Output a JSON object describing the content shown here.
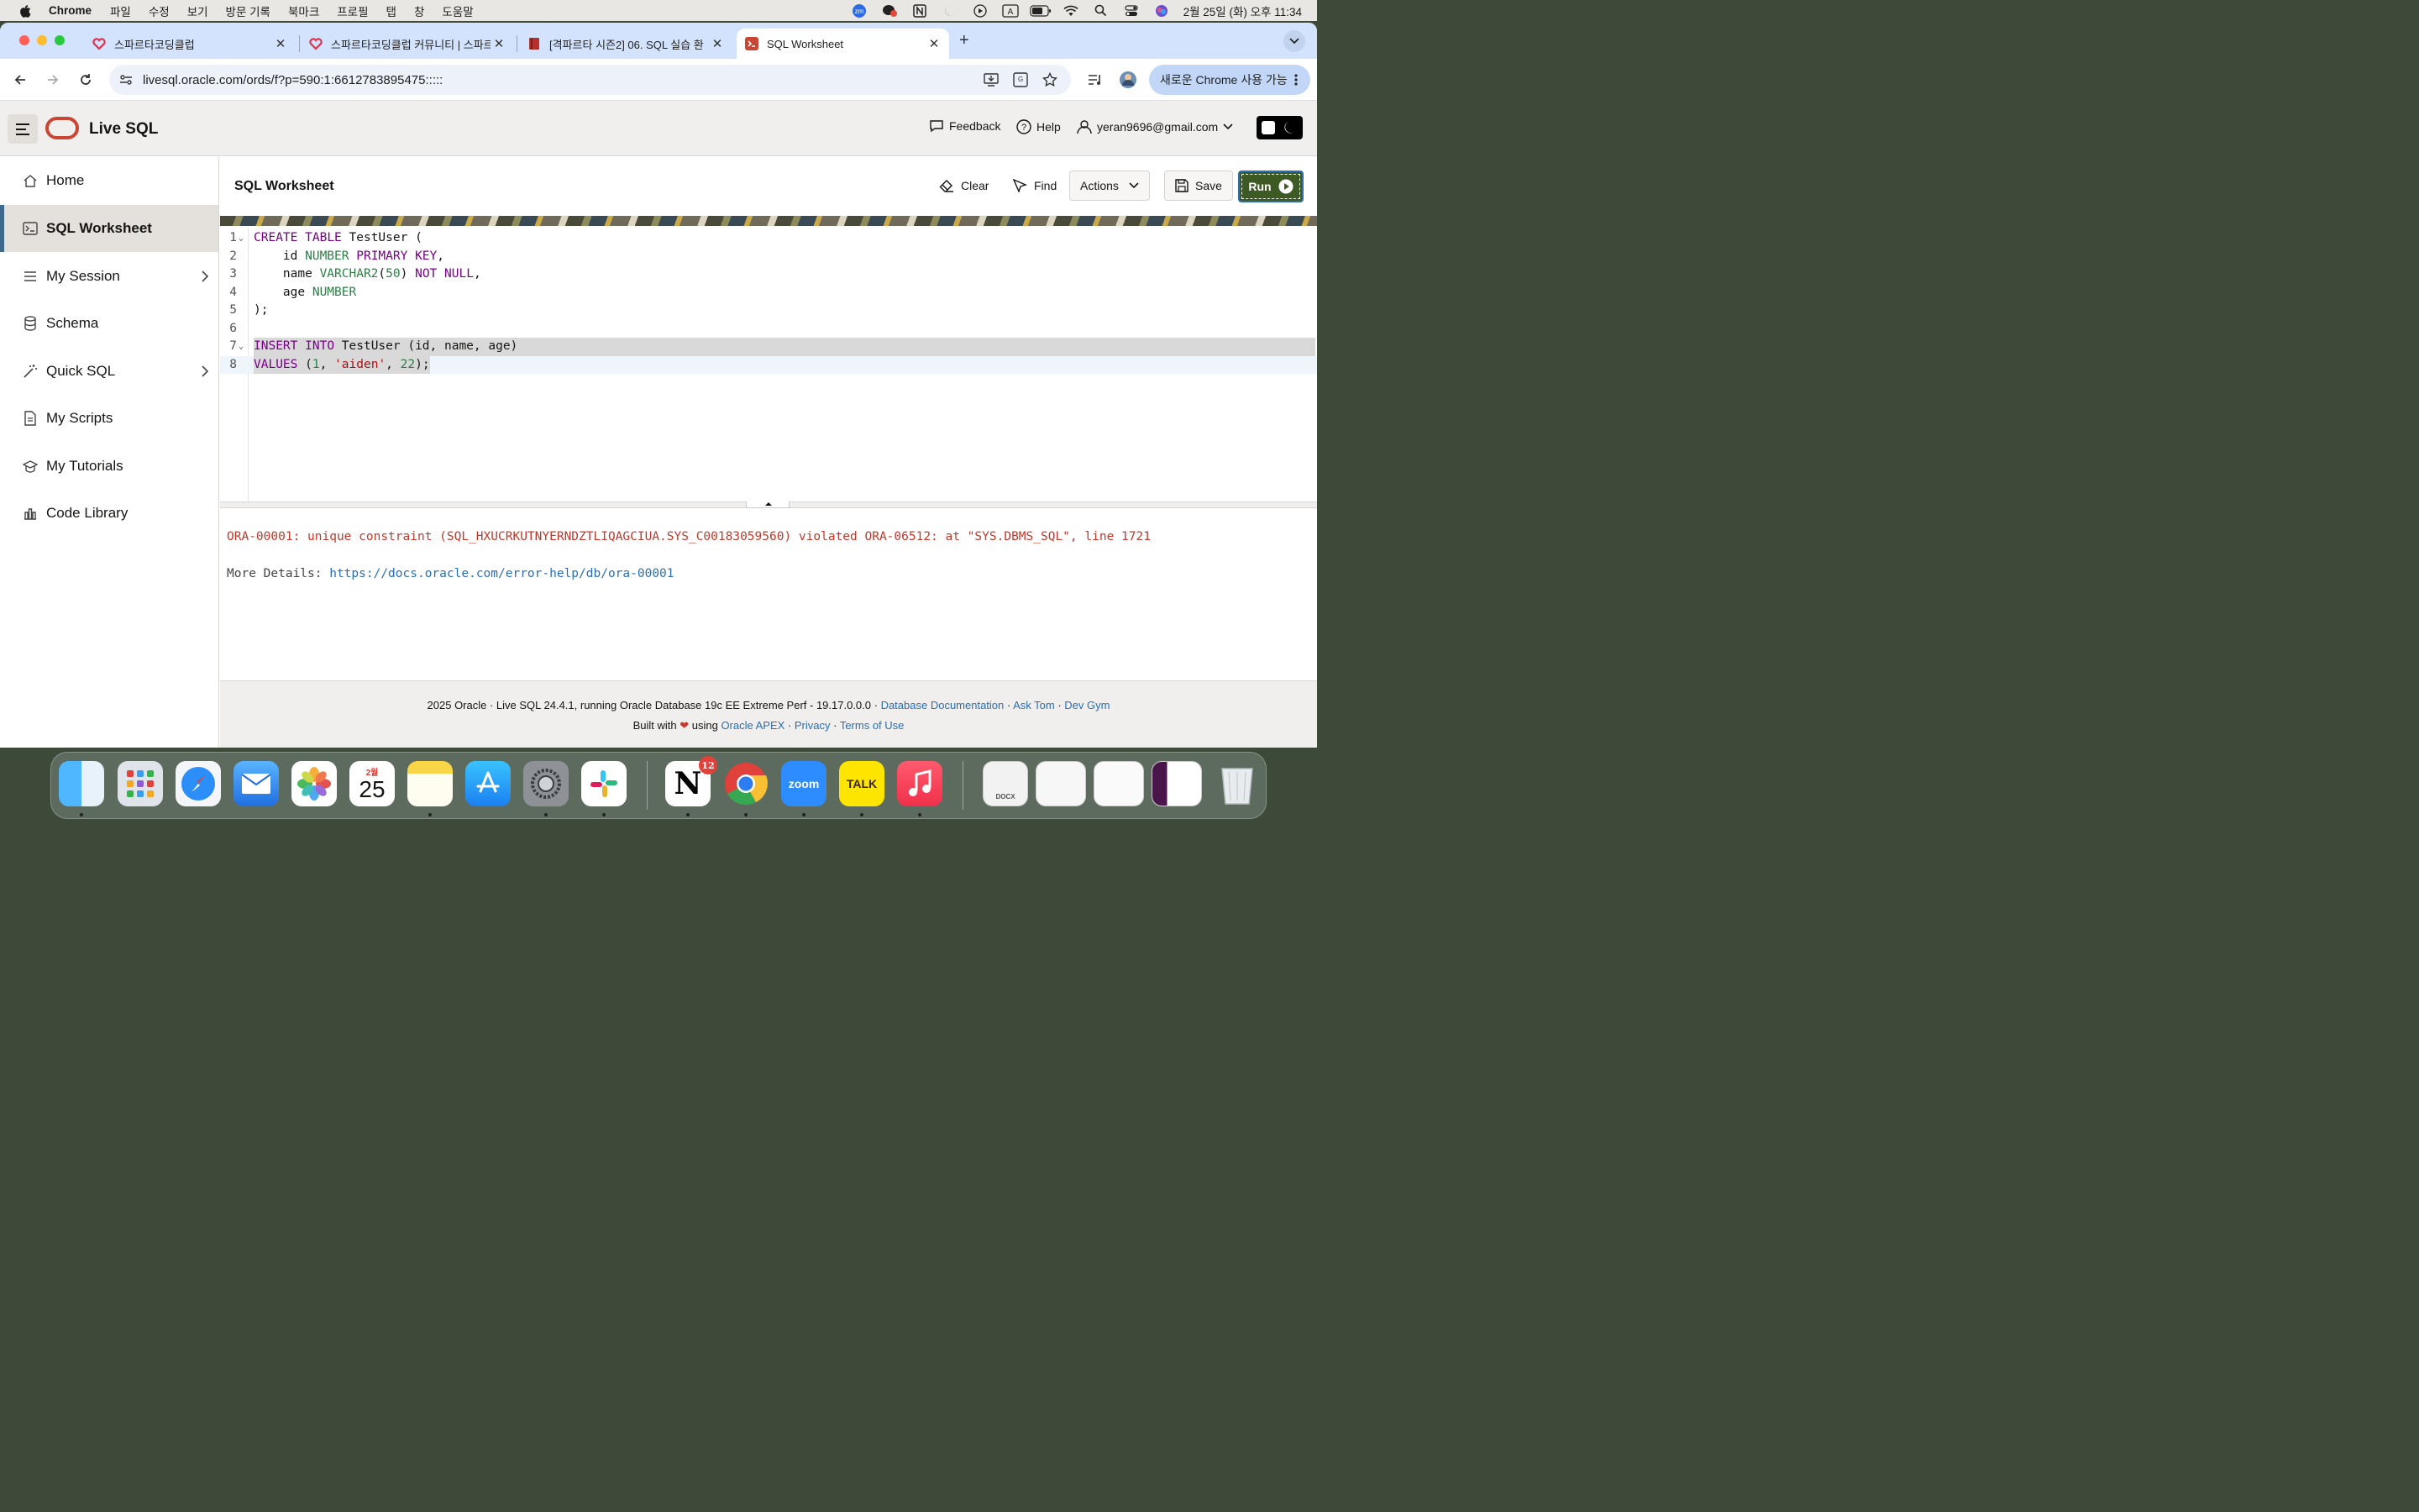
{
  "menubar": {
    "app_name": "Chrome",
    "items": [
      "파일",
      "수정",
      "보기",
      "방문 기록",
      "북마크",
      "프로필",
      "탭",
      "창",
      "도움말"
    ],
    "status_icons": [
      "zoom-icon",
      "chat-icon",
      "notion-icon",
      "moon-icon",
      "play-icon",
      "input-source-icon",
      "battery-icon",
      "wifi-icon",
      "spotlight-icon",
      "control-center-icon",
      "siri-icon"
    ],
    "input_source": "A",
    "clock": "2월 25일 (화) 오후 11:34"
  },
  "browser": {
    "tabs": [
      {
        "title": "스파르타코딩클럽"
      },
      {
        "title": "스파르타코딩클럽 커뮤니티 | 스파르"
      },
      {
        "title": "[격파르타 시즌2] 06. SQL 실습 환"
      },
      {
        "title": "SQL Worksheet"
      }
    ],
    "new_tab": "+",
    "url": "livesql.oracle.com/ords/f?p=590:1:6612783895475:::::",
    "update_button": "새로운 Chrome 사용 가능"
  },
  "app": {
    "title": "Live SQL",
    "feedback": "Feedback",
    "help": "Help",
    "user": "yeran9696@gmail.com"
  },
  "sidebar": {
    "items": [
      {
        "label": "Home"
      },
      {
        "label": "SQL Worksheet"
      },
      {
        "label": "My Session"
      },
      {
        "label": "Schema"
      },
      {
        "label": "Quick SQL"
      },
      {
        "label": "My Scripts"
      },
      {
        "label": "My Tutorials"
      },
      {
        "label": "Code Library"
      }
    ]
  },
  "worksheet": {
    "title": "SQL Worksheet",
    "clear": "Clear",
    "find": "Find",
    "actions": "Actions",
    "save": "Save",
    "run": "Run"
  },
  "editor": {
    "line_numbers": [
      "1",
      "2",
      "3",
      "4",
      "5",
      "6",
      "7",
      "8"
    ],
    "line1": {
      "a": "CREATE",
      "b": " ",
      "c": "TABLE",
      "d": " TestUser ("
    },
    "line2": {
      "a": "    id ",
      "b": "NUMBER",
      "c": " ",
      "d": "PRIMARY",
      "e": " ",
      "f": "KEY",
      "g": ","
    },
    "line3": {
      "a": "    name ",
      "b": "VARCHAR2",
      "c": "(",
      "d": "50",
      "e": ") ",
      "f": "NOT",
      "g": " ",
      "h": "NULL",
      "i": ","
    },
    "line4": {
      "a": "    age ",
      "b": "NUMBER"
    },
    "line5": {
      "a": ");"
    },
    "line7": {
      "a": "INSERT",
      "b": " ",
      "c": "INTO",
      "d": " TestUser (id, name, age)"
    },
    "line8": {
      "a": "VALUES",
      "b": " (",
      "c": "1",
      "d": ", ",
      "e": "'aiden'",
      "f": ", ",
      "g": "22",
      "h": ");"
    }
  },
  "output": {
    "error": "ORA-00001: unique constraint (SQL_HXUCRKUTNYERNDZTLIQAGCIUA.SYS_C00183059560) violated ORA-06512: at \"SYS.DBMS_SQL\", line 1721",
    "details_label": "More Details: ",
    "details_link": "https://docs.oracle.com/error-help/db/ora-00001"
  },
  "footer": {
    "line1_text": "2025 Oracle · Live SQL 24.4.1, running Oracle Database 19c EE Extreme Perf - 19.17.0.0.0 · ",
    "doc_link": "Database Documentation",
    "sep1": " · ",
    "asktom": "Ask Tom",
    "sep2": " · ",
    "devgym": "Dev Gym",
    "built_with": "Built with ",
    "using": " using ",
    "apex": "Oracle APEX",
    "sep3": " · ",
    "privacy": "Privacy",
    "sep4": " · ",
    "terms": "Terms of Use"
  },
  "dock": {
    "calendar_month": "2월",
    "calendar_day": "25",
    "notion_badge": "12",
    "zoom_label": "zoom",
    "talk_label": "TALK",
    "docx_label": "DOCX"
  },
  "colors": {
    "oracle_red": "#c74634",
    "run_green": "#3e5a24",
    "error_red": "#c0392b",
    "link_blue": "#2a6fb5",
    "active_bar": "#3e6a8e"
  }
}
